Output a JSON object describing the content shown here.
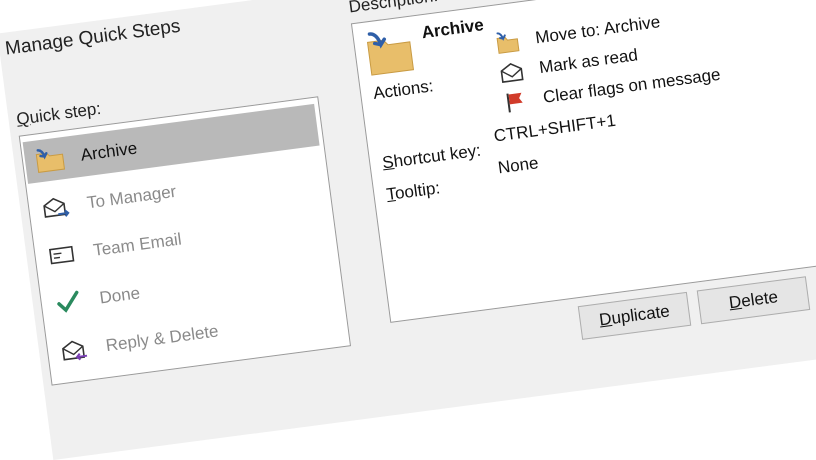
{
  "window": {
    "title": "Manage Quick Steps"
  },
  "left": {
    "label_prefix": "",
    "label_underlined": "Q",
    "label_rest": "uick step:",
    "items": [
      {
        "label": "Archive",
        "icon": "archive-folder-icon",
        "selected": true
      },
      {
        "label": "To Manager",
        "icon": "forward-mail-icon",
        "selected": false
      },
      {
        "label": "Team Email",
        "icon": "envelope-icon",
        "selected": false
      },
      {
        "label": "Done",
        "icon": "checkmark-icon",
        "selected": false
      },
      {
        "label": "Reply & Delete",
        "icon": "reply-mail-icon",
        "selected": false
      }
    ]
  },
  "description": {
    "label": "Description:",
    "title": "Archive",
    "actions_label": "Actions:",
    "actions": [
      {
        "text": "Move to: Archive",
        "icon": "move-folder-icon"
      },
      {
        "text": "Mark as read",
        "icon": "open-envelope-icon"
      },
      {
        "text": "Clear flags on message",
        "icon": "red-flag-icon"
      }
    ],
    "shortcut_label_underlined": "S",
    "shortcut_label_rest": "hortcut key:",
    "shortcut_value": "CTRL+SHIFT+1",
    "tooltip_label_underlined": "T",
    "tooltip_label_rest": "ooltip:",
    "tooltip_value": "None"
  },
  "buttons": {
    "duplicate_prefix": "D",
    "duplicate_rest": "uplicate",
    "delete_underlined": "D",
    "delete_rest": "elete"
  },
  "colors": {
    "selected_bg": "#b9b9b9",
    "folder": "#e8be6a",
    "arrow": "#2f5fa8",
    "check": "#2a8a5e",
    "flag": "#d13b2a",
    "reply": "#7a3fb5"
  }
}
